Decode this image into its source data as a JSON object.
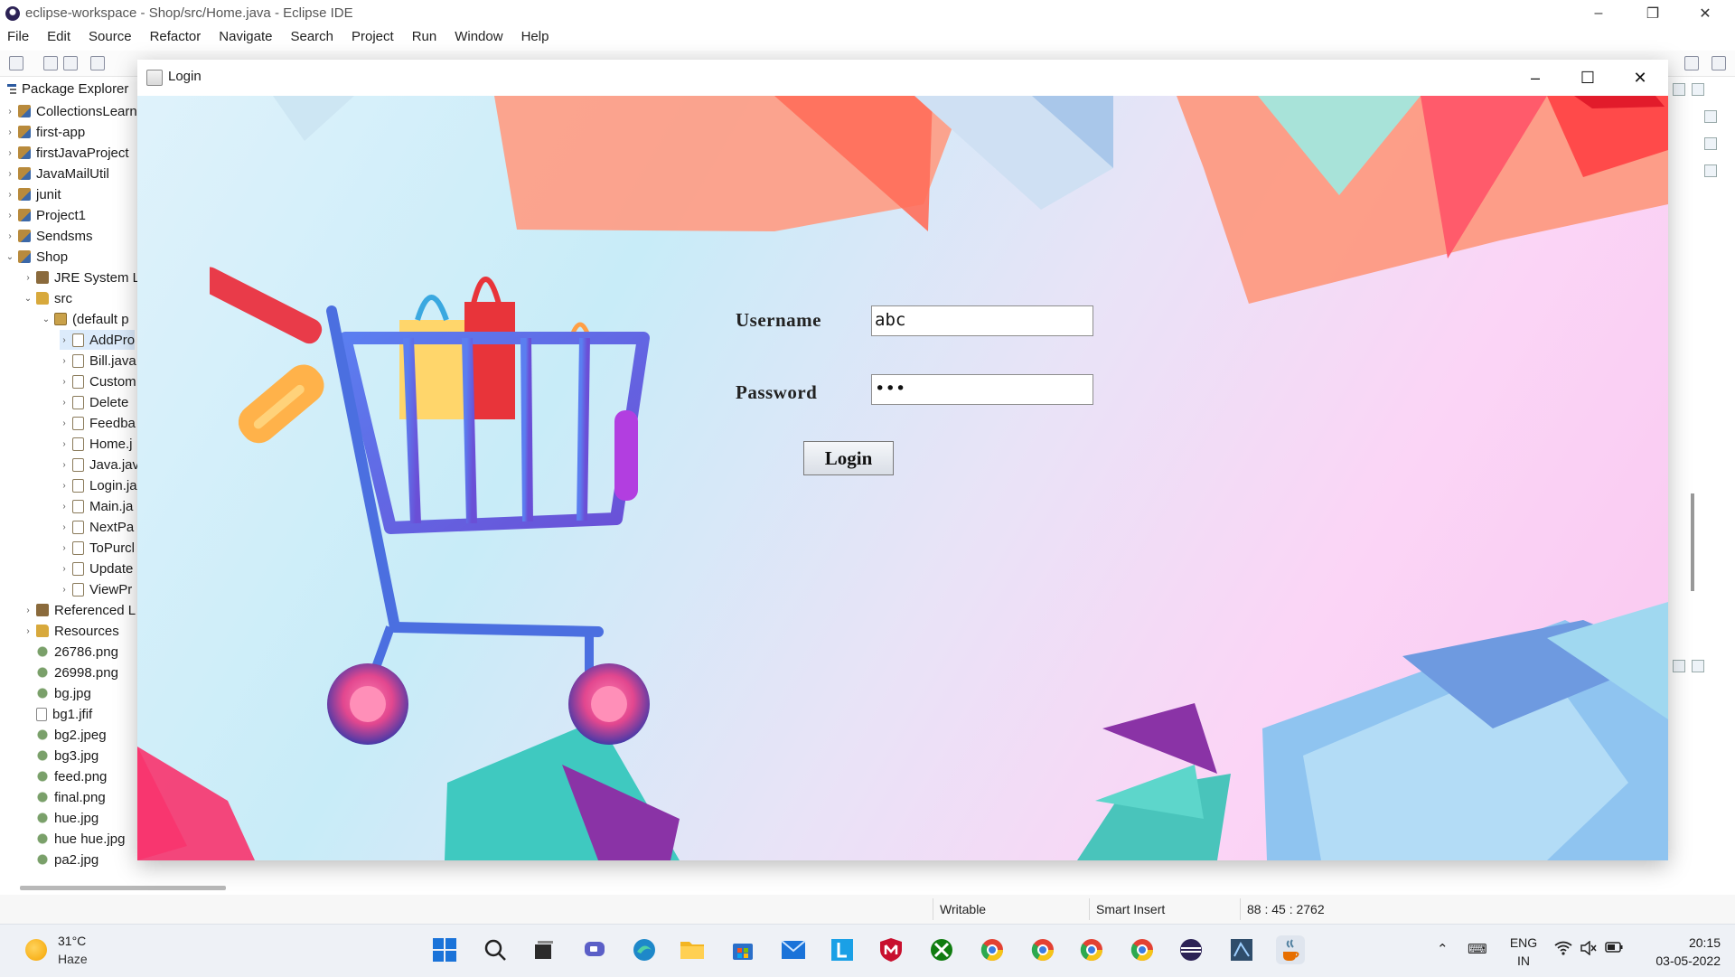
{
  "eclipse": {
    "title": "eclipse-workspace - Shop/src/Home.java - Eclipse IDE",
    "menu": [
      "File",
      "Edit",
      "Source",
      "Refactor",
      "Navigate",
      "Search",
      "Project",
      "Run",
      "Window",
      "Help"
    ],
    "package_explorer": {
      "title": "Package Explorer",
      "items": [
        {
          "label": "CollectionsLearn",
          "depth": 0,
          "twisty": "›",
          "icon": "proj"
        },
        {
          "label": "first-app",
          "depth": 0,
          "twisty": "›",
          "icon": "proj"
        },
        {
          "label": "firstJavaProject",
          "depth": 0,
          "twisty": "›",
          "icon": "proj"
        },
        {
          "label": "JavaMailUtil",
          "depth": 0,
          "twisty": "›",
          "icon": "proj"
        },
        {
          "label": "junit",
          "depth": 0,
          "twisty": "›",
          "icon": "proj"
        },
        {
          "label": "Project1",
          "depth": 0,
          "twisty": "›",
          "icon": "proj"
        },
        {
          "label": "Sendsms",
          "depth": 0,
          "twisty": "›",
          "icon": "proj"
        },
        {
          "label": "Shop",
          "depth": 0,
          "twisty": "⌄",
          "icon": "proj"
        },
        {
          "label": "JRE System Li",
          "depth": 1,
          "twisty": "›",
          "icon": "lib"
        },
        {
          "label": "src",
          "depth": 1,
          "twisty": "⌄",
          "icon": "folder"
        },
        {
          "label": "(default p",
          "depth": 2,
          "twisty": "⌄",
          "icon": "pkg"
        },
        {
          "label": "AddPro",
          "depth": 3,
          "twisty": "›",
          "icon": "java",
          "selected": true
        },
        {
          "label": "Bill.java",
          "depth": 3,
          "twisty": "›",
          "icon": "java"
        },
        {
          "label": "Custom",
          "depth": 3,
          "twisty": "›",
          "icon": "java"
        },
        {
          "label": "Delete",
          "depth": 3,
          "twisty": "›",
          "icon": "java"
        },
        {
          "label": "Feedba",
          "depth": 3,
          "twisty": "›",
          "icon": "java"
        },
        {
          "label": "Home.j",
          "depth": 3,
          "twisty": "›",
          "icon": "java"
        },
        {
          "label": "Java.jav",
          "depth": 3,
          "twisty": "›",
          "icon": "java"
        },
        {
          "label": "Login.ja",
          "depth": 3,
          "twisty": "›",
          "icon": "java"
        },
        {
          "label": "Main.ja",
          "depth": 3,
          "twisty": "›",
          "icon": "java"
        },
        {
          "label": "NextPa",
          "depth": 3,
          "twisty": "›",
          "icon": "java"
        },
        {
          "label": "ToPurcl",
          "depth": 3,
          "twisty": "›",
          "icon": "java"
        },
        {
          "label": "Update",
          "depth": 3,
          "twisty": "›",
          "icon": "java"
        },
        {
          "label": "ViewPr",
          "depth": 3,
          "twisty": "›",
          "icon": "java"
        },
        {
          "label": "Referenced L",
          "depth": 1,
          "twisty": "›",
          "icon": "lib"
        },
        {
          "label": "Resources",
          "depth": 1,
          "twisty": "›",
          "icon": "folder"
        },
        {
          "label": "26786.png",
          "depth": 1,
          "twisty": "",
          "icon": "img"
        },
        {
          "label": "26998.png",
          "depth": 1,
          "twisty": "",
          "icon": "img"
        },
        {
          "label": "bg.jpg",
          "depth": 1,
          "twisty": "",
          "icon": "img"
        },
        {
          "label": "bg1.jfif",
          "depth": 1,
          "twisty": "",
          "icon": "file"
        },
        {
          "label": "bg2.jpeg",
          "depth": 1,
          "twisty": "",
          "icon": "img"
        },
        {
          "label": "bg3.jpg",
          "depth": 1,
          "twisty": "",
          "icon": "img"
        },
        {
          "label": "feed.png",
          "depth": 1,
          "twisty": "",
          "icon": "img"
        },
        {
          "label": "final.png",
          "depth": 1,
          "twisty": "",
          "icon": "img"
        },
        {
          "label": "hue.jpg",
          "depth": 1,
          "twisty": "",
          "icon": "img"
        },
        {
          "label": "hue hue.jpg",
          "depth": 1,
          "twisty": "",
          "icon": "img"
        },
        {
          "label": "pa2.jpg",
          "depth": 1,
          "twisty": "",
          "icon": "img"
        }
      ]
    },
    "status": {
      "writable": "Writable",
      "insert_mode": "Smart Insert",
      "position": "88 : 45 : 2762"
    }
  },
  "login": {
    "window_title": "Login",
    "username_label": "Username",
    "username_value": "abc",
    "password_label": "Password",
    "password_value": "•••",
    "login_button": "Login"
  },
  "taskbar": {
    "weather_temp": "31°C",
    "weather_desc": "Haze",
    "lang_top": "ENG",
    "lang_bottom": "IN",
    "time": "20:15",
    "date": "03-05-2022",
    "apps": [
      "start",
      "search",
      "task-view",
      "chat",
      "edge",
      "file-explorer",
      "store",
      "mail",
      "editor-l",
      "mcafee",
      "xbox",
      "chrome",
      "chrome",
      "chrome",
      "chrome",
      "eclipse",
      "network-app",
      "java"
    ]
  }
}
